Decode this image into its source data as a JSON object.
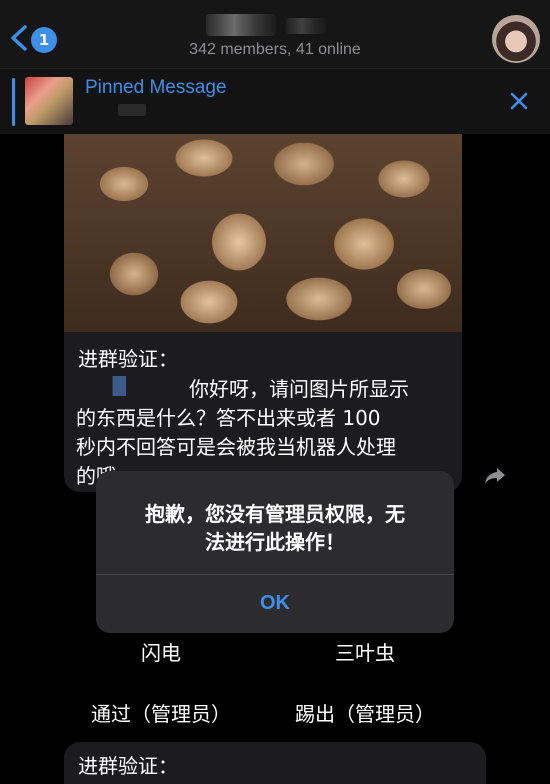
{
  "header": {
    "unread_count": "1",
    "members_status": "342 members, 41 online",
    "back_icon": "chevron-left-icon",
    "accent_color": "#3d8fe8"
  },
  "pinned": {
    "title": "Pinned Message",
    "close_icon": "close-icon"
  },
  "message": {
    "verify_label": "进群验证：",
    "lines": [
      "你好呀，请问图片所显示",
      "的东西是什么？答不出来或者 100",
      "秒内不回答可是会被我当机器人处理",
      "的哦"
    ]
  },
  "keyboard_buttons": {
    "option_1": "闪电",
    "option_2": "三叶虫",
    "approve_admin": "通过（管理员）",
    "kick_admin": "踢出（管理员）"
  },
  "next_message": {
    "verify_label": "进群验证："
  },
  "alert": {
    "message_line_1": "抱歉，您没有管理员权限，无",
    "message_line_2": "法进行此操作！",
    "ok_label": "OK"
  }
}
